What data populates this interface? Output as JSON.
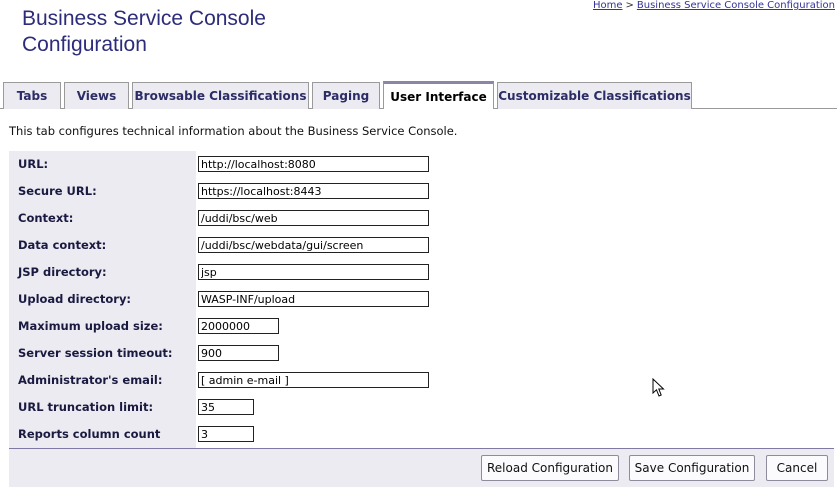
{
  "header": {
    "title_line1": "Business Service Console",
    "title_line2": "Configuration",
    "breadcrumb": {
      "home": "Home",
      "separator": ">",
      "current": "Business Service Console Configuration"
    }
  },
  "tabs": [
    {
      "label": "Tabs",
      "active": false
    },
    {
      "label": "Views",
      "active": false
    },
    {
      "label": "Browsable Classifications",
      "active": false
    },
    {
      "label": "Paging",
      "active": false
    },
    {
      "label": "User Interface",
      "active": true
    },
    {
      "label": "Customizable Classifications",
      "active": false
    }
  ],
  "intro": "This tab configures technical information about the Business Service Console.",
  "fields": [
    {
      "label": "URL:",
      "value": "http://localhost:8080"
    },
    {
      "label": "Secure URL:",
      "value": "https://localhost:8443"
    },
    {
      "label": "Context:",
      "value": "/uddi/bsc/web"
    },
    {
      "label": "Data context:",
      "value": "/uddi/bsc/webdata/gui/screen"
    },
    {
      "label": "JSP directory:",
      "value": "jsp"
    },
    {
      "label": "Upload directory:",
      "value": "WASP-INF/upload"
    },
    {
      "label": "Maximum upload size:",
      "value": "2000000"
    },
    {
      "label": "Server session timeout:",
      "value": "900"
    },
    {
      "label": "Administrator's email:",
      "value": "[ admin e-mail ]"
    },
    {
      "label": "URL truncation limit:",
      "value": "35"
    },
    {
      "label": "Reports column count",
      "value": "3"
    }
  ],
  "buttons": {
    "reload": "Reload Configuration",
    "save": "Save Configuration",
    "cancel": "Cancel"
  },
  "colors": {
    "title": "#2c2c7a",
    "panel": "#ecebf2",
    "tab_accent": "#8a86a8"
  }
}
